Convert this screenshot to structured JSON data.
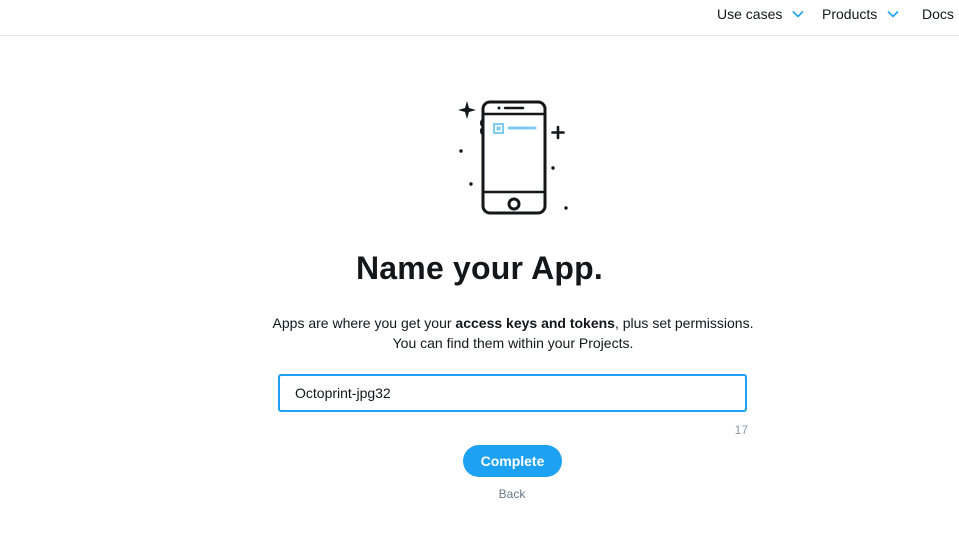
{
  "nav": {
    "items": [
      {
        "label": "Use cases",
        "icon": "chevron-down-icon"
      },
      {
        "label": "Products",
        "icon": "chevron-down-icon"
      },
      {
        "label": "Docs"
      }
    ]
  },
  "illustration": {
    "icon": "phone-sparkle-icon"
  },
  "main": {
    "title": "Name your App.",
    "description": {
      "part1": "Apps are where you get your ",
      "bold": "access keys and tokens",
      "part2": ", plus set permissions.",
      "line2": "You can find them within your Projects."
    },
    "input": {
      "value": "Octoprint-jpg32"
    },
    "char_count": "17",
    "complete_label": "Complete",
    "back_label": "Back"
  },
  "colors": {
    "accent": "#1da1f2",
    "text": "#14171a",
    "muted": "#8899a6",
    "link": "#657786",
    "illustration_accent": "#7fcbf2"
  }
}
